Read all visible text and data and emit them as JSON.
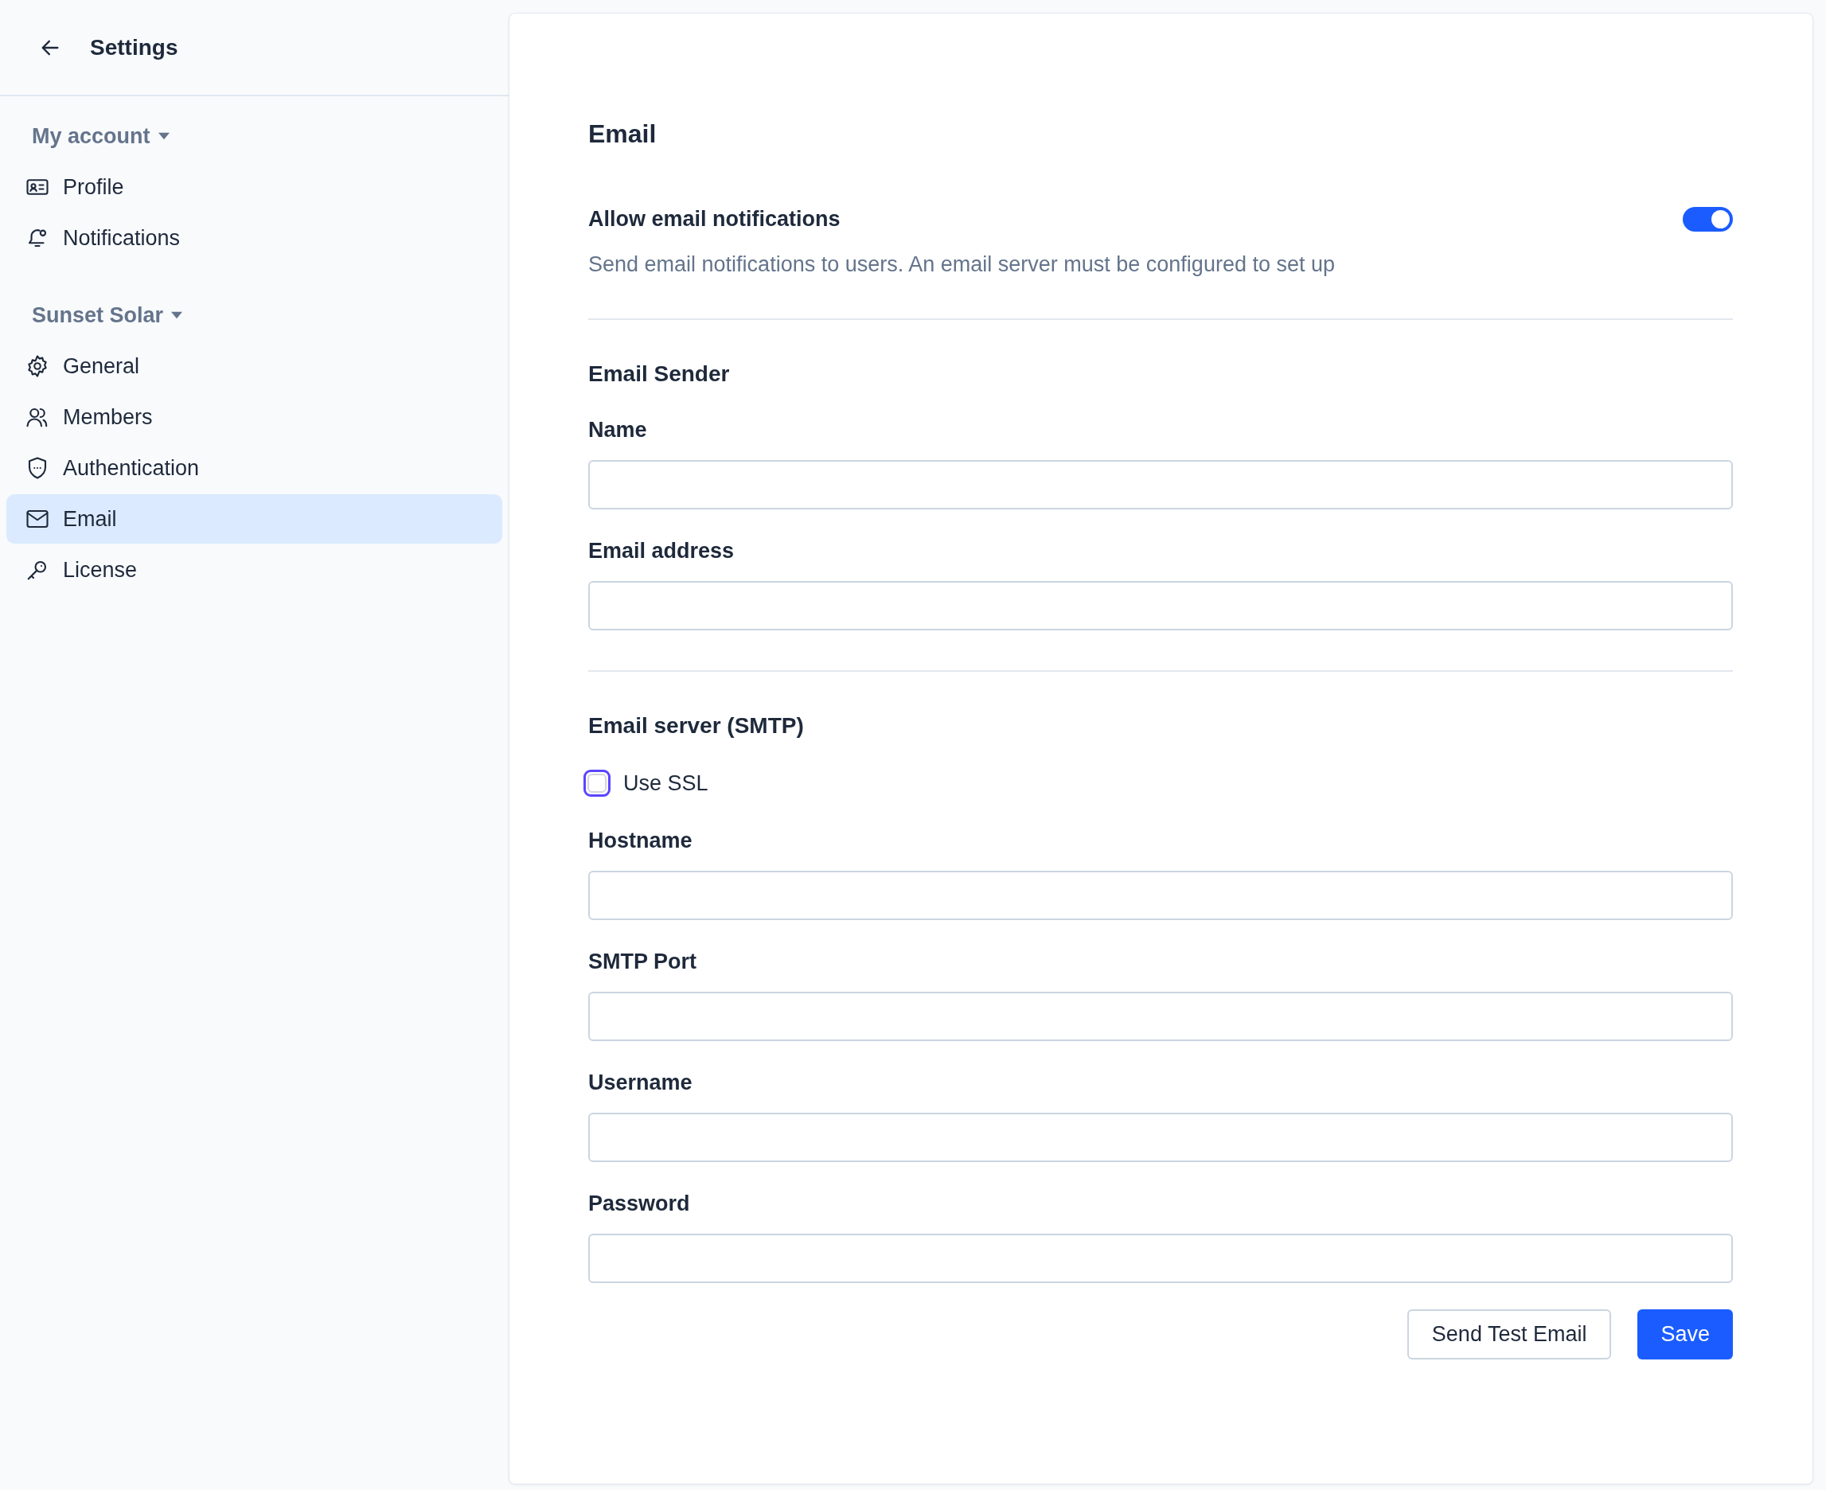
{
  "sidebar": {
    "title": "Settings",
    "groups": [
      {
        "label": "My account",
        "items": [
          {
            "label": "Profile",
            "selected": false
          },
          {
            "label": "Notifications",
            "selected": false
          }
        ]
      },
      {
        "label": "Sunset Solar",
        "items": [
          {
            "label": "General",
            "selected": false
          },
          {
            "label": "Members",
            "selected": false
          },
          {
            "label": "Authentication",
            "selected": false
          },
          {
            "label": "Email",
            "selected": true
          },
          {
            "label": "License",
            "selected": false
          }
        ]
      }
    ]
  },
  "email_settings": {
    "title": "Email",
    "notifications": {
      "label": "Allow email notifications",
      "description": "Send email notifications to users. An email server must be configured to set up",
      "on": true
    },
    "sections": [
      {
        "title": "Email Sender",
        "fields": [
          {
            "kind": "text",
            "label": "Name"
          },
          {
            "kind": "text",
            "label": "Email address"
          }
        ]
      },
      {
        "title": "Email server (SMTP)",
        "fields": [
          {
            "kind": "checkbox",
            "label": "Use SSL",
            "checked": false
          },
          {
            "kind": "text",
            "label": "Hostname"
          },
          {
            "kind": "text",
            "label": "SMTP Port"
          },
          {
            "kind": "text",
            "label": "Username"
          },
          {
            "kind": "password",
            "label": "Password"
          }
        ]
      }
    ],
    "buttons": [
      {
        "kind": "secondary",
        "label": "Send Test Email"
      },
      {
        "kind": "primary",
        "label": "Save"
      }
    ]
  }
}
